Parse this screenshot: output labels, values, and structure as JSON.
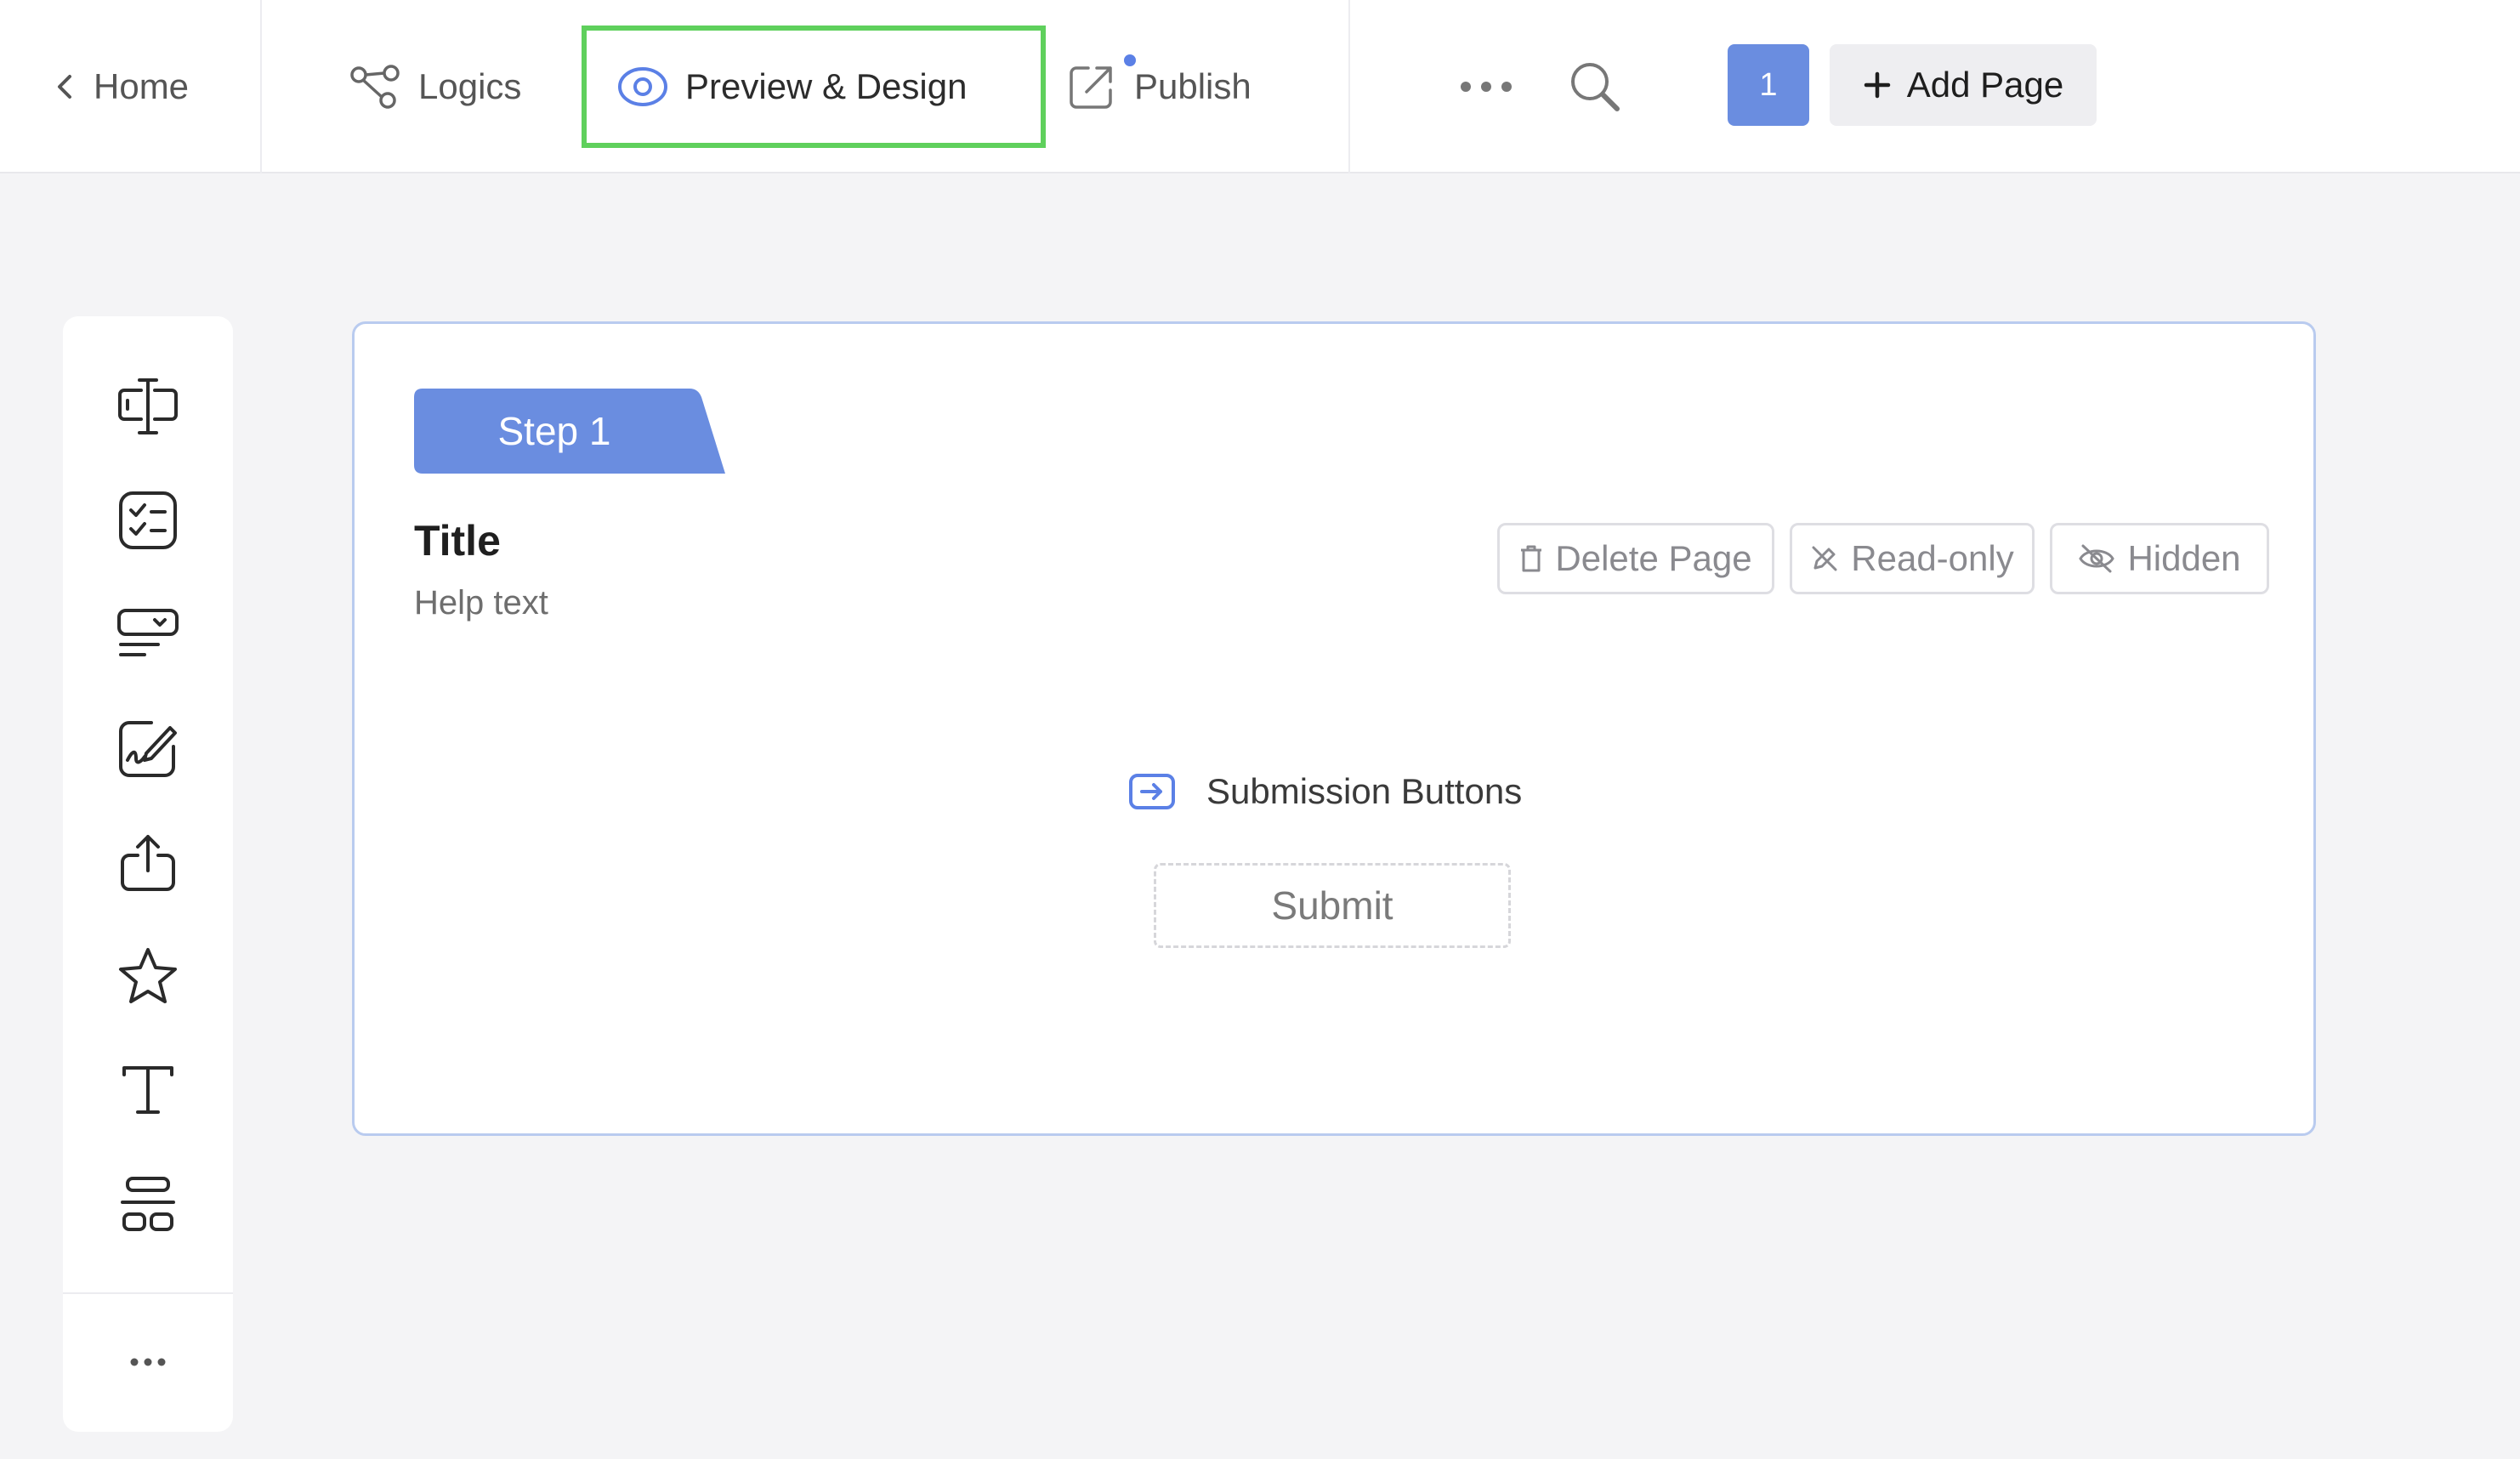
{
  "header": {
    "home_label": "Home",
    "logics_label": "Logics",
    "preview_label": "Preview & Design",
    "publish_label": "Publish",
    "page_number": "1",
    "add_page_label": "Add Page"
  },
  "sidebar": {
    "tools": [
      {
        "icon": "text-input-icon"
      },
      {
        "icon": "checklist-icon"
      },
      {
        "icon": "dropdown-select-icon"
      },
      {
        "icon": "signature-icon"
      },
      {
        "icon": "upload-icon"
      },
      {
        "icon": "star-rating-icon"
      },
      {
        "icon": "text-icon"
      },
      {
        "icon": "layout-icon"
      }
    ],
    "more_icon": "more-horizontal-icon"
  },
  "page": {
    "step_label": "Step 1",
    "title": "Title",
    "help_text": "Help text",
    "delete_label": "Delete Page",
    "readonly_label": "Read-only",
    "hidden_label": "Hidden",
    "submission_label": "Submission Buttons",
    "submit_label": "Submit"
  },
  "colors": {
    "accent": "#6a8de0",
    "active_outline": "#5fd05c",
    "canvas_border": "#b9cbef",
    "background": "#f4f4f6"
  }
}
